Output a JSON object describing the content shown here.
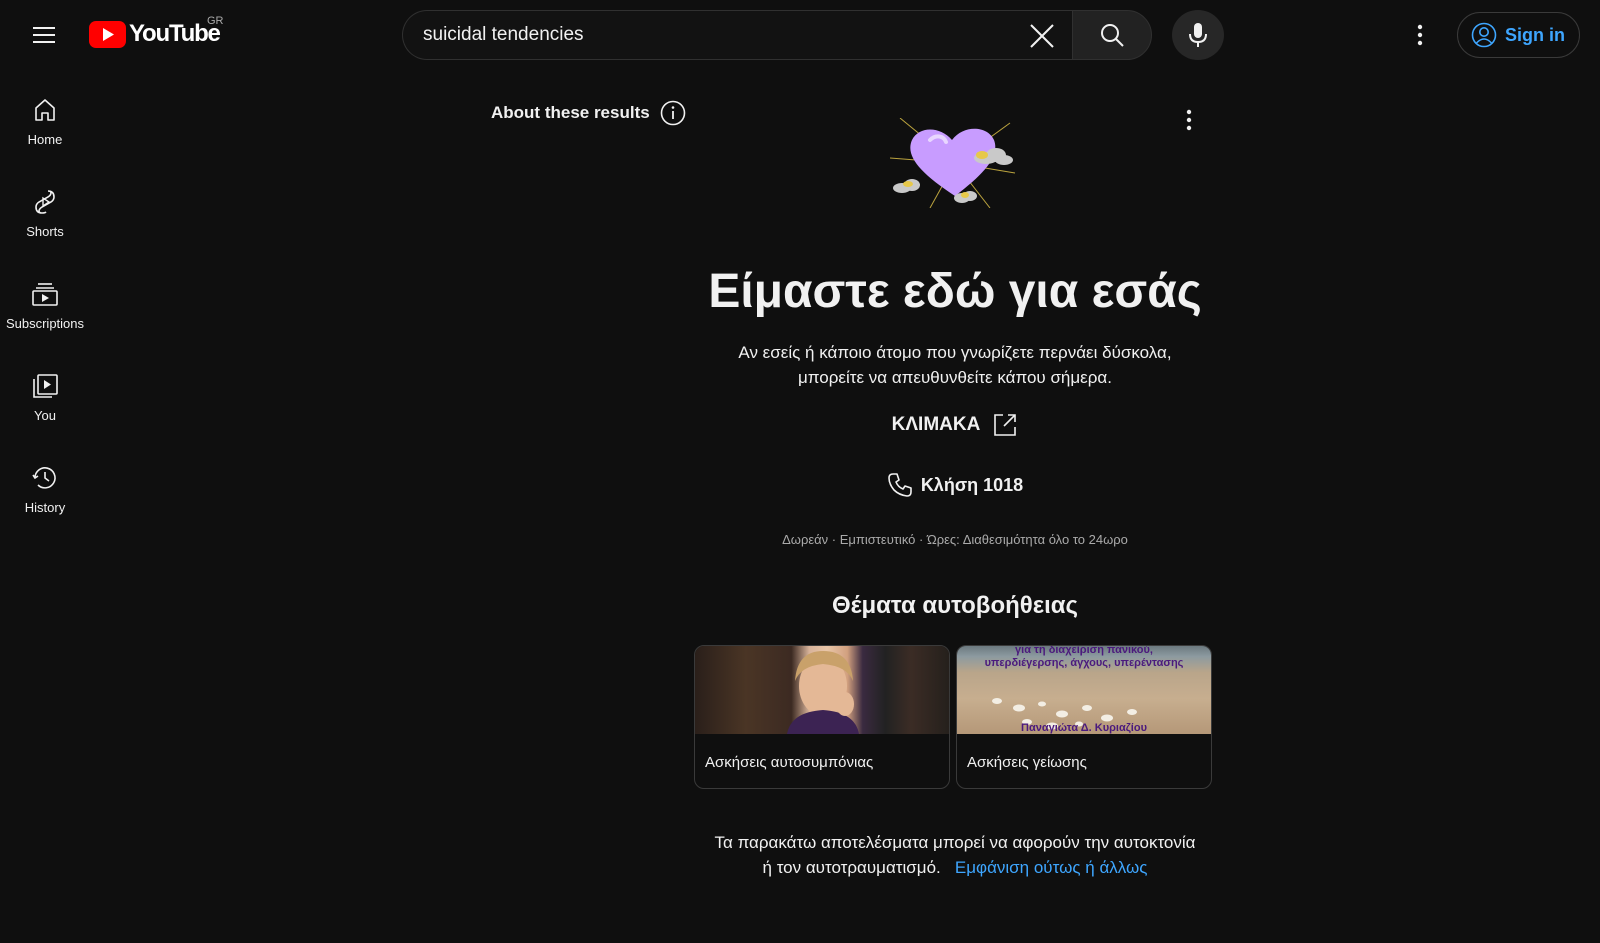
{
  "header": {
    "logo_text": "YouTube",
    "region": "GR",
    "search_value": "suicidal tendencies",
    "signin_label": "Sign in"
  },
  "sidebar": {
    "items": [
      {
        "label": "Home",
        "icon": "home-icon"
      },
      {
        "label": "Shorts",
        "icon": "shorts-icon"
      },
      {
        "label": "Subscriptions",
        "icon": "subscriptions-icon"
      },
      {
        "label": "You",
        "icon": "you-icon"
      },
      {
        "label": "History",
        "icon": "history-icon"
      }
    ]
  },
  "main": {
    "about_label": "About these results",
    "headline": "Είμαστε εδώ για εσάς",
    "subtext_line1": "Αν εσείς ή κάποιο άτομο που γνωρίζετε περνάει δύσκολα,",
    "subtext_line2": "μπορείτε να απευθυνθείτε κάπου σήμερα.",
    "org_link": "ΚΛΙΜΑΚΑ",
    "call_label": "Κλήση 1018",
    "availability": "Δωρεάν · Εμπιστευτικό · Ώρες: Διαθεσιμότητα όλο το 24ωρο",
    "topics_title": "Θέματα αυτοβοήθειας",
    "topics": [
      {
        "label": "Ασκήσεις αυτοσυμπόνιας"
      },
      {
        "label": "Ασκήσεις γείωσης",
        "thumb_text_top": "για τη διαχείριση πανικού,",
        "thumb_text_mid": "υπερδιέγερσης, άγχους, υπερέντασης",
        "thumb_text_bottom": "Παναγιώτα Δ. Κυριαζίου"
      }
    ],
    "warning_text": "Τα παρακάτω αποτελέσματα μπορεί να αφορούν την αυτοκτονία ή τον αυτοτραυματισμό.",
    "show_anyway_link": "Εμφάνιση ούτως ή άλλως"
  },
  "colors": {
    "background": "#0f0f0f",
    "link": "#3ea6ff",
    "youtube_red": "#ff0000",
    "heart": "#c89cff"
  }
}
